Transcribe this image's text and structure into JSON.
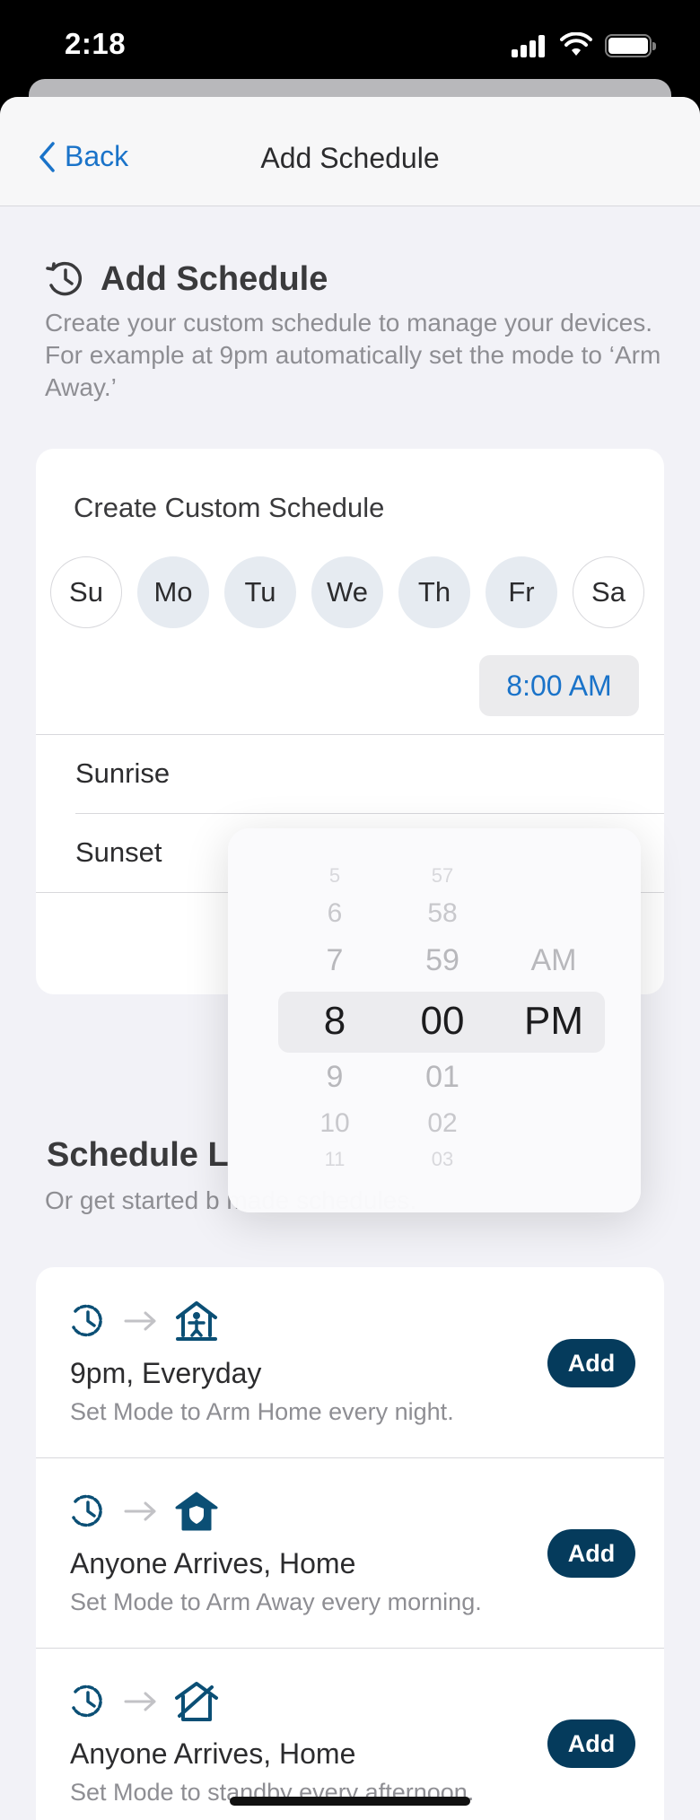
{
  "status": {
    "time": "2:18"
  },
  "nav": {
    "back_label": "Back",
    "title": "Add Schedule"
  },
  "intro": {
    "title": "Add Schedule",
    "description": "Create your custom schedule to manage your devices. For example at 9pm automatically set the mode to ‘Arm Away.’"
  },
  "custom": {
    "title": "Create Custom Schedule",
    "days": [
      {
        "label": "Su",
        "selected": false
      },
      {
        "label": "Mo",
        "selected": true
      },
      {
        "label": "Tu",
        "selected": true
      },
      {
        "label": "We",
        "selected": true
      },
      {
        "label": "Th",
        "selected": true
      },
      {
        "label": "Fr",
        "selected": true
      },
      {
        "label": "Sa",
        "selected": false
      }
    ],
    "time": "8:00 AM",
    "rows": [
      "Sunrise",
      "Sunset"
    ]
  },
  "picker": {
    "hours": [
      "5",
      "6",
      "7",
      "8",
      "9",
      "10",
      "11"
    ],
    "minutes": [
      "57",
      "58",
      "59",
      "00",
      "01",
      "02",
      "03"
    ],
    "periods": [
      "AM",
      "PM"
    ],
    "selected": {
      "hour": "8",
      "minute": "00",
      "period": "PM"
    }
  },
  "library": {
    "title": "Schedule L",
    "description": "Or get started b                                                 made schedules.",
    "items": [
      {
        "name": "9pm, Everyday",
        "subtitle": "Set Mode to Arm Home every night.",
        "button": "Add",
        "mode_icon": "arm-home-icon"
      },
      {
        "name": "Anyone Arrives, Home",
        "subtitle": "Set Mode to Arm Away every morning.",
        "button": "Add",
        "mode_icon": "arm-away-icon"
      },
      {
        "name": "Anyone Arrives, Home",
        "subtitle": "Set Mode to standby every afternoon.",
        "button": "Add",
        "mode_icon": "standby-icon"
      }
    ]
  },
  "colors": {
    "accent": "#1a73c9",
    "brand": "#053b5c",
    "icon": "#0b4f75"
  }
}
